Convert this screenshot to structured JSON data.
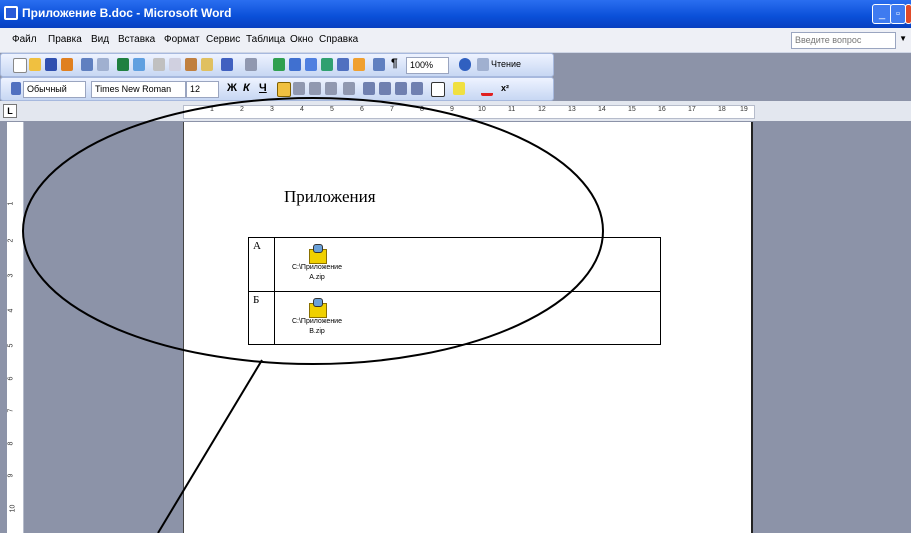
{
  "window": {
    "title": "Приложение B.doc - Microsoft Word"
  },
  "menu": {
    "items": [
      "Файл",
      "Правка",
      "Вид",
      "Вставка",
      "Формат",
      "Сервис",
      "Таблица",
      "Окно",
      "Справка"
    ],
    "ask_placeholder": "Введите вопрос"
  },
  "toolbar": {
    "zoom": "100%",
    "reading_label": "Чтение",
    "style": "Обычный",
    "font": "Times New Roman",
    "size": "12",
    "bold": "Ж",
    "italic": "К",
    "underline": "Ч"
  },
  "ruler": {
    "h_ticks": [
      "1",
      "2",
      "3",
      "4",
      "5",
      "6",
      "7",
      "8",
      "9",
      "10",
      "11",
      "12",
      "13",
      "14",
      "15",
      "16",
      "17",
      "18",
      "19"
    ],
    "v_ticks": [
      "1",
      "2",
      "3",
      "4",
      "5",
      "6",
      "7",
      "8",
      "9",
      "10"
    ]
  },
  "document": {
    "heading": "Приложения",
    "rows": [
      {
        "letter": "А",
        "object_line1": "C:\\Приложение",
        "object_line2": "A.zip"
      },
      {
        "letter": "Б",
        "object_line1": "C:\\Приложение",
        "object_line2": "B.zip"
      }
    ]
  }
}
